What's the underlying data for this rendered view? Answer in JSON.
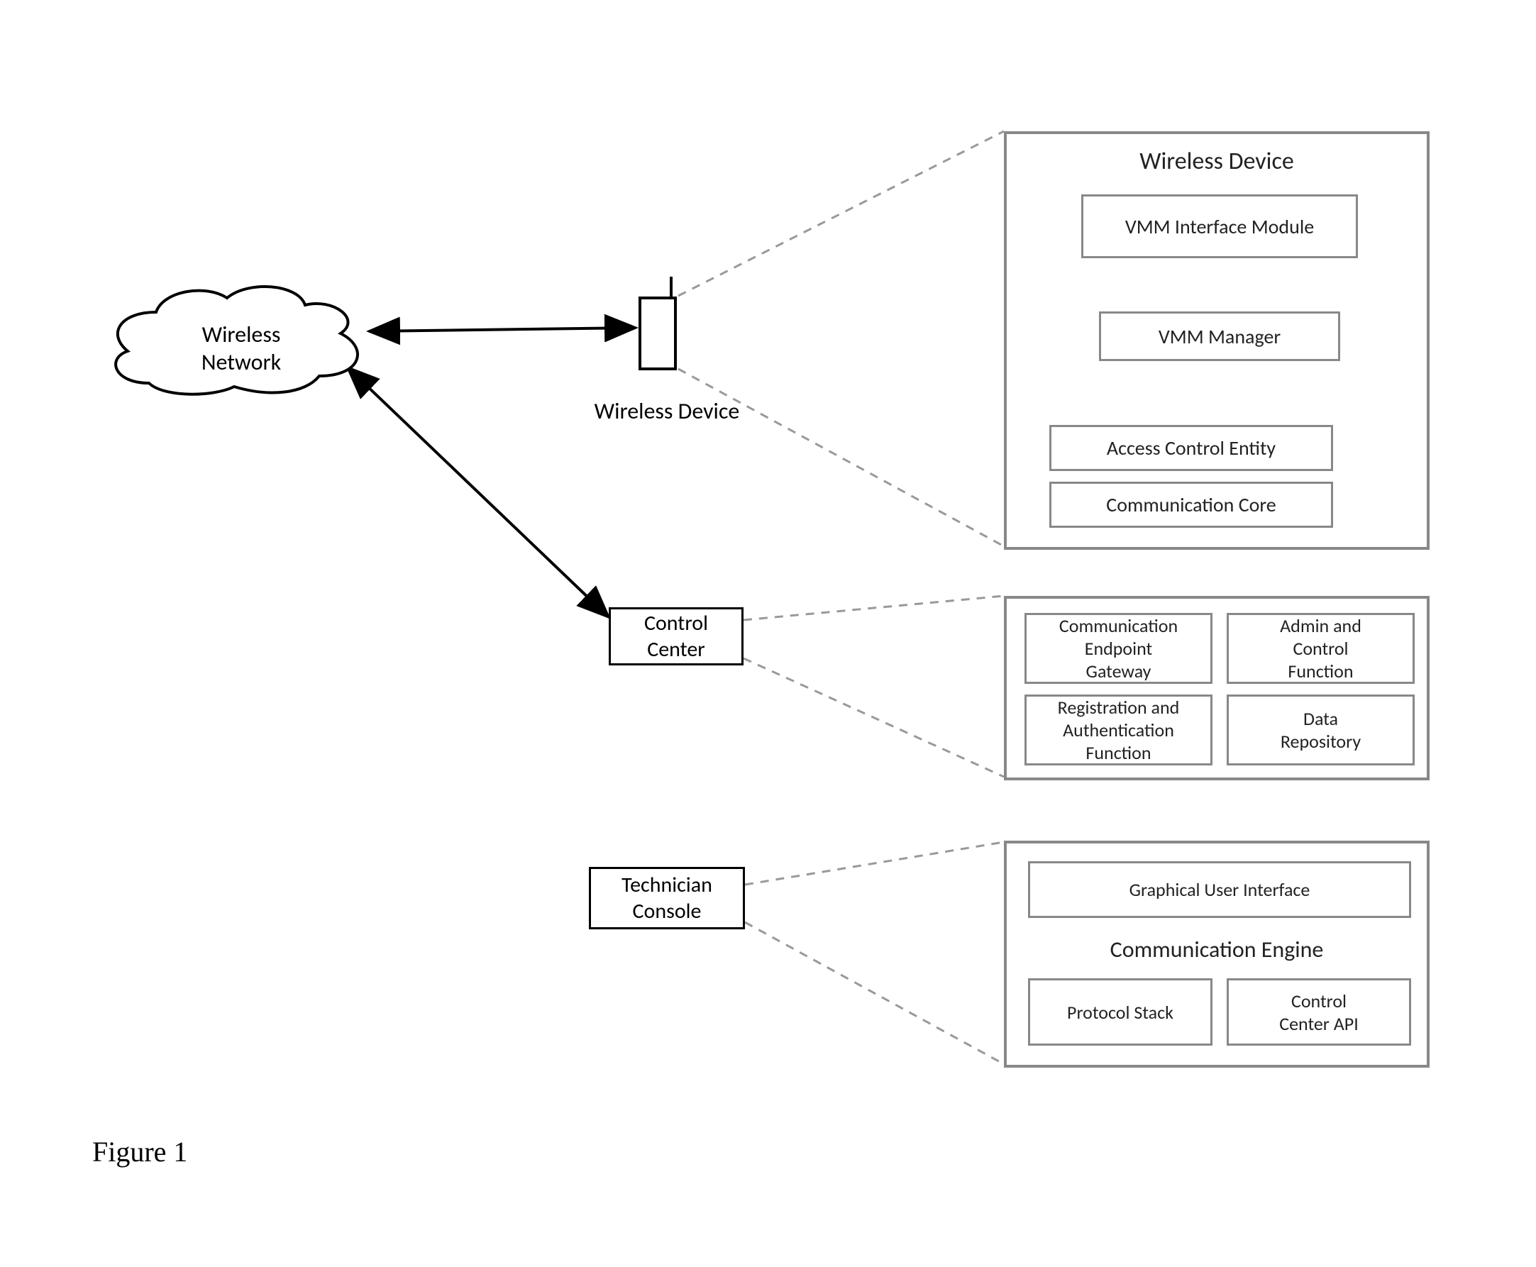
{
  "cloud": {
    "label": "Wireless\nNetwork"
  },
  "wireless_device_small": {
    "caption": "Wireless Device"
  },
  "control_center": {
    "label": "Control\nCenter"
  },
  "tech_console": {
    "label": "Technician\nConsole"
  },
  "panel_device": {
    "title": "Wireless Device",
    "vmm_interface": "VMM Interface Module",
    "vmm_manager": "VMM Manager",
    "access_control": "Access Control Entity",
    "comm_core": "Communication Core"
  },
  "panel_control": {
    "comm_gateway": "Communication\nEndpoint\nGateway",
    "admin_control": "Admin and\nControl\nFunction",
    "reg_auth": "Registration and\nAuthentication\nFunction",
    "data_repo": "Data\nRepository"
  },
  "panel_tech": {
    "gui": "Graphical User Interface",
    "comm_engine_title": "Communication Engine",
    "protocol_stack": "Protocol Stack",
    "cc_api": "Control\nCenter API"
  },
  "figure_caption": "Figure 1"
}
